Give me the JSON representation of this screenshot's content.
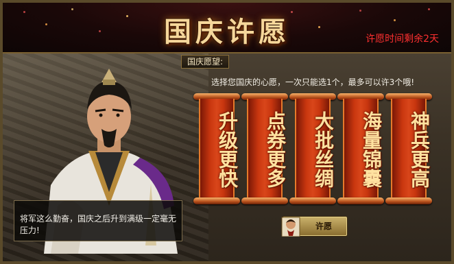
{
  "header": {
    "title": "国庆许愿",
    "countdown": "许愿时间剩余2天"
  },
  "wish_section": {
    "label": "国庆愿望:",
    "instruction": "选择您国庆的心愿，一次只能选1个，最多可以许3个哦!"
  },
  "wishes": [
    {
      "text": "升级更快"
    },
    {
      "text": "点券更多"
    },
    {
      "text": "大批丝绸"
    },
    {
      "text": "海量锦囊"
    },
    {
      "text": "神兵更高"
    }
  ],
  "dialog": {
    "text": "将军这么勤奋，国庆之后升到满级一定毫无压力!"
  },
  "actions": {
    "wish_button": "许愿"
  },
  "colors": {
    "title": "#f6d79a",
    "countdown": "#ff3030",
    "scroll": "#c8360f"
  }
}
